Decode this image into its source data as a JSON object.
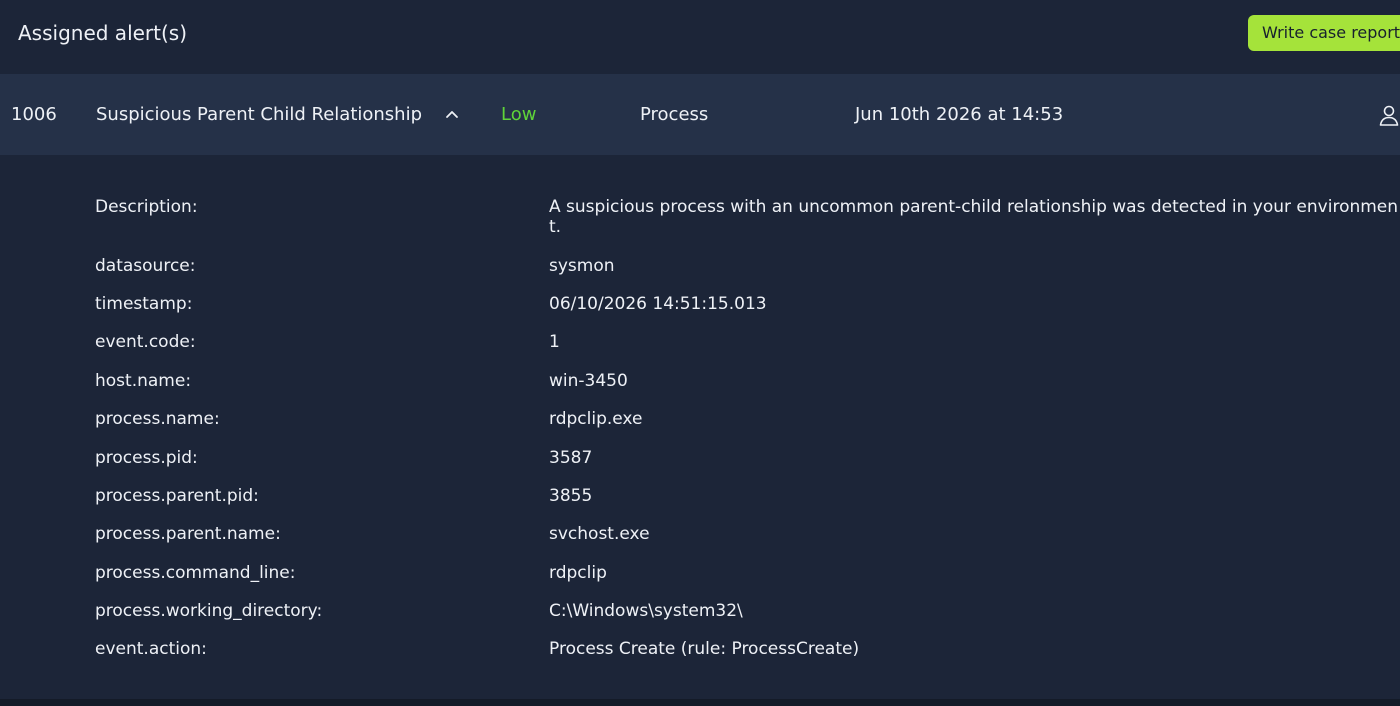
{
  "header": {
    "title": "Assigned alert(s)",
    "report_button_label": "Write case report"
  },
  "alert": {
    "id": "1006",
    "name": "Suspicious Parent Child Relationship",
    "severity": "Low",
    "type": "Process",
    "time": "Jun 10th 2026 at 14:53"
  },
  "details": [
    {
      "key": "Description:",
      "value": "A suspicious process with an uncommon parent-child relationship was detected in your environment."
    },
    {
      "key": "datasource:",
      "value": "sysmon"
    },
    {
      "key": "timestamp:",
      "value": "06/10/2026 14:51:15.013"
    },
    {
      "key": "event.code:",
      "value": "1"
    },
    {
      "key": "host.name:",
      "value": "win-3450"
    },
    {
      "key": "process.name:",
      "value": "rdpclip.exe"
    },
    {
      "key": "process.pid:",
      "value": "3587"
    },
    {
      "key": "process.parent.pid:",
      "value": "3855"
    },
    {
      "key": "process.parent.name:",
      "value": "svchost.exe"
    },
    {
      "key": "process.command_line:",
      "value": "rdpclip"
    },
    {
      "key": "process.working_directory:",
      "value": "C:\\Windows\\system32\\"
    },
    {
      "key": "event.action:",
      "value": "Process Create (rule: ProcessCreate)"
    }
  ],
  "colors": {
    "background": "#1c2538",
    "row_background": "#253148",
    "accent_button": "#a5e33a",
    "severity_low": "#5fd339"
  },
  "icons": {
    "expand": "chevron-up-icon",
    "assignee": "user-icon"
  }
}
